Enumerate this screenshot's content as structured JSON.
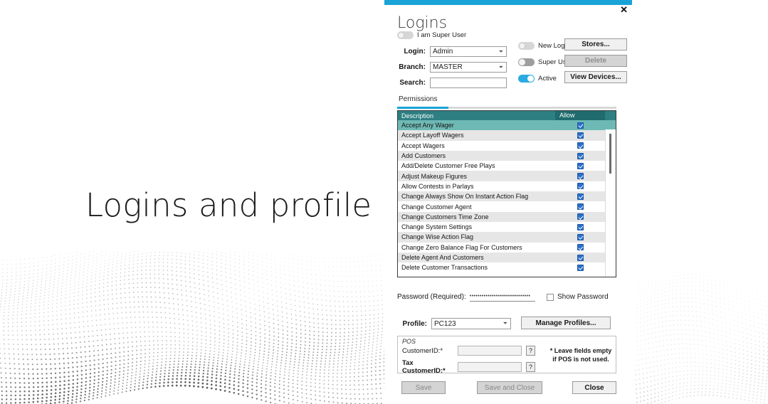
{
  "slide": {
    "title": "Logins and profile",
    "background_color": "#ffffff",
    "dot_color": "#3a3a3a"
  },
  "dialog": {
    "title": "Logins",
    "accent_color": "#1aa3d6",
    "close_icon": "close-icon",
    "close_label": "✕",
    "super_user_top": {
      "label": "I am Super User",
      "state": "off"
    },
    "fields": [
      {
        "label": "Login:",
        "value": "Admin",
        "type": "combo"
      },
      {
        "label": "Branch:",
        "value": "MASTER",
        "type": "combo"
      },
      {
        "label": "Search:",
        "value": "",
        "type": "text",
        "placeholder": ""
      }
    ],
    "toggles": [
      {
        "label": "New Login",
        "state": "off"
      },
      {
        "label": "Super User",
        "state": "off-dark"
      },
      {
        "label": "Active",
        "state": "on"
      }
    ],
    "side_buttons": [
      {
        "label": "Stores...",
        "disabled": false
      },
      {
        "label": "Delete",
        "disabled": true
      },
      {
        "label": "View Devices...",
        "disabled": false
      }
    ],
    "permissions_tab": {
      "label": "Permissions",
      "active": true
    },
    "permissions_grid": {
      "header_description": "Description",
      "header_allow": "Allow",
      "header_bg": "#2e7f82",
      "header_allow_bg": "#1f6b6e",
      "selected_bg": "#6fb9b5",
      "checkbox_color": "#2a6fc9",
      "rows": [
        {
          "description": "Accept Any Wager",
          "allow": true,
          "selected": true
        },
        {
          "description": "Accept Layoff Wagers",
          "allow": true,
          "selected": false
        },
        {
          "description": "Accept Wagers",
          "allow": true,
          "selected": false
        },
        {
          "description": "Add Customers",
          "allow": true,
          "selected": false
        },
        {
          "description": "Add/Delete Customer Free Plays",
          "allow": true,
          "selected": false
        },
        {
          "description": "Adjust Makeup Figures",
          "allow": true,
          "selected": false
        },
        {
          "description": "Allow Contests in Parlays",
          "allow": true,
          "selected": false
        },
        {
          "description": "Change Always Show On Instant Action Flag",
          "allow": true,
          "selected": false
        },
        {
          "description": "Change Customer Agent",
          "allow": true,
          "selected": false
        },
        {
          "description": "Change Customers Time Zone",
          "allow": true,
          "selected": false
        },
        {
          "description": "Change System Settings",
          "allow": true,
          "selected": false
        },
        {
          "description": "Change Wise Action Flag",
          "allow": true,
          "selected": false
        },
        {
          "description": "Change Zero Balance Flag For Customers",
          "allow": true,
          "selected": false
        },
        {
          "description": "Delete Agent And Customers",
          "allow": true,
          "selected": false
        },
        {
          "description": "Delete Customer Transactions",
          "allow": true,
          "selected": false
        }
      ]
    },
    "password": {
      "label": "Password (Required):",
      "value": "••••••••••••••••••••••••••••••",
      "show_password_label": "Show Password",
      "show_password_checked": false
    },
    "profile": {
      "label": "Profile:",
      "value": "PC123",
      "manage_button": "Manage Profiles..."
    },
    "pos": {
      "caption": "POS",
      "customer_id_label": "CustomerID:*",
      "customer_id_value": "",
      "tax_customer_id_label": "Tax CustomerID:*",
      "tax_customer_id_value": "",
      "help_label": "?",
      "note_line1": "* Leave fields empty",
      "note_line2": "if POS is not used."
    },
    "bottom_buttons": [
      {
        "label": "Save",
        "disabled": true
      },
      {
        "label": "Save and Close",
        "disabled": true
      },
      {
        "label": "Close",
        "disabled": false
      }
    ]
  }
}
